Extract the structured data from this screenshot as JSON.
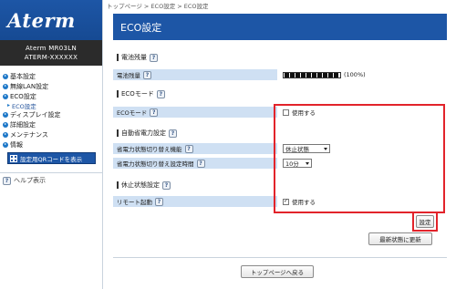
{
  "sidebar": {
    "logo": "Aterm",
    "model_line1": "Aterm MR03LN",
    "model_line2": "ATERM-XXXXXX",
    "nav_items": [
      {
        "label": "基本設定"
      },
      {
        "label": "無線LAN設定"
      },
      {
        "label": "ECO設定"
      }
    ],
    "nav_sub": {
      "label": "ECO設定"
    },
    "nav_items2": [
      {
        "label": "ディスプレイ設定"
      },
      {
        "label": "詳細設定"
      },
      {
        "label": "メンテナンス"
      },
      {
        "label": "情報"
      }
    ],
    "qr_button": "設定用QRコードを表示",
    "help_link": "ヘルプ表示"
  },
  "breadcrumb": "トップページ > ECO設定 > ECO設定",
  "page_title": "ECO設定",
  "sections": {
    "battery": {
      "heading": "電池残量",
      "label": "電池残量",
      "percent_text": "(100%)",
      "level": 1.0,
      "segments": 10
    },
    "eco_mode": {
      "heading": "ECOモード",
      "label": "ECOモード",
      "checkbox_label": "使用する",
      "checked": false
    },
    "auto_power": {
      "heading": "自動省電力設定",
      "switch_label": "省電力状態切り替え機能",
      "switch_value": "休止状態",
      "time_label": "省電力状態切り替え設定時間",
      "time_value": "10分"
    },
    "sleep": {
      "heading": "休止状態設定",
      "label": "リモート起動",
      "checkbox_label": "使用する",
      "checked": true,
      "check_mark": "✓"
    }
  },
  "help_mark": "?",
  "buttons": {
    "set": "設定",
    "refresh": "最新状態に更新",
    "back_top": "トップページへ戻る"
  },
  "colors": {
    "brand_blue": "#1d56a6",
    "row_blue": "#cfe0f3",
    "highlight_red": "#e2232a"
  }
}
